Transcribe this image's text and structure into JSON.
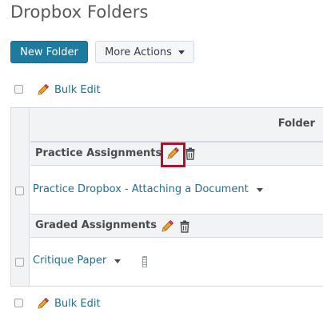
{
  "page": {
    "title": "Dropbox Folders"
  },
  "toolbar": {
    "new_folder_label": "New Folder",
    "more_actions_label": "More Actions"
  },
  "bulk_edit_top": {
    "label": "Bulk Edit"
  },
  "bulk_edit_bottom": {
    "label": "Bulk Edit"
  },
  "table": {
    "column_header": "Folder",
    "categories": [
      {
        "name": "Practice Assignments",
        "items": [
          {
            "label": "Practice Dropbox - Attaching a Document"
          }
        ]
      },
      {
        "name": "Graded Assignments",
        "items": [
          {
            "label": "Critique Paper"
          }
        ]
      }
    ]
  },
  "colors": {
    "primary_button": "#1e7ba0",
    "link": "#236e8f",
    "highlight_border": "#a3162f",
    "pencil": "#e0a92a"
  },
  "icons": {
    "pencil": "pencil-icon",
    "trash": "trash-icon",
    "dropdown": "chevron-down-icon"
  }
}
